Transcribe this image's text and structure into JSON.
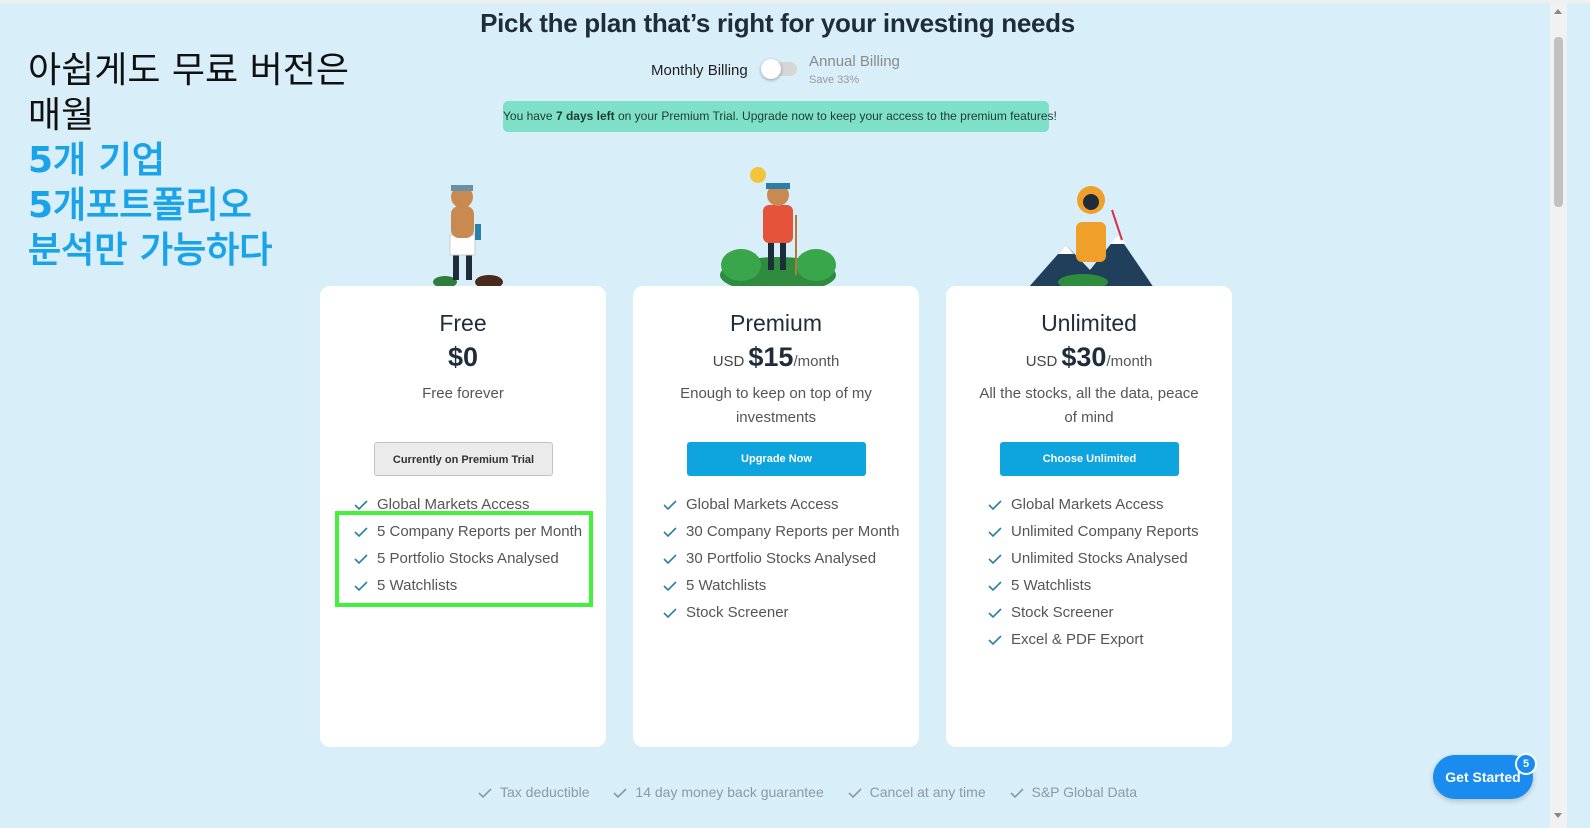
{
  "page": {
    "title": "Pick the plan that’s right for your investing needs"
  },
  "billing": {
    "monthly_label": "Monthly Billing",
    "annual_label": "Annual Billing",
    "annual_note": "Save 33%",
    "annual_selected": false
  },
  "trial_banner": {
    "prefix": "You have ",
    "highlight": "7 days left",
    "suffix": " on your Premium Trial. Upgrade now to keep your access to the premium features!"
  },
  "annotation": {
    "lines": [
      "아쉽게도 무료 버전은",
      "매월"
    ],
    "highlight_lines": [
      "5개 기업",
      "5개포트폴리오",
      "분석만 가능하다"
    ],
    "highlight_color": "#1aa3e8"
  },
  "plans": [
    {
      "name": "Free",
      "currency": "",
      "price": "$0",
      "period": "",
      "description": "Free forever",
      "button_label": "Currently on Premium Trial",
      "features": [
        "Global Markets Access",
        "5 Company Reports per Month",
        "5 Portfolio Stocks Analysed",
        "5 Watchlists"
      ]
    },
    {
      "name": "Premium",
      "currency": "USD",
      "price": "$15",
      "period": "/month",
      "description": "Enough to keep on top of my investments",
      "button_label": "Upgrade Now",
      "features": [
        "Global Markets Access",
        "30 Company Reports per Month",
        "30 Portfolio Stocks Analysed",
        "5 Watchlists",
        "Stock Screener"
      ]
    },
    {
      "name": "Unlimited",
      "currency": "USD",
      "price": "$30",
      "period": "/month",
      "description": "All the stocks, all the data, peace of mind",
      "button_label": "Choose Unlimited",
      "features": [
        "Global Markets Access",
        "Unlimited Company Reports",
        "Unlimited Stocks Analysed",
        "5 Watchlists",
        "Stock Screener",
        "Excel & PDF Export"
      ]
    }
  ],
  "guarantees": [
    "Tax deductible",
    "14 day money back guarantee",
    "Cancel at any time",
    "S&P Global Data"
  ],
  "chat_widget": {
    "label": "Get Started",
    "badge": "5"
  },
  "colors": {
    "background": "#d8eef8",
    "primary_button": "#0ea5de",
    "banner": "#7fe0c8",
    "highlight_box": "#43f03c",
    "check": "#2d7fa8"
  }
}
